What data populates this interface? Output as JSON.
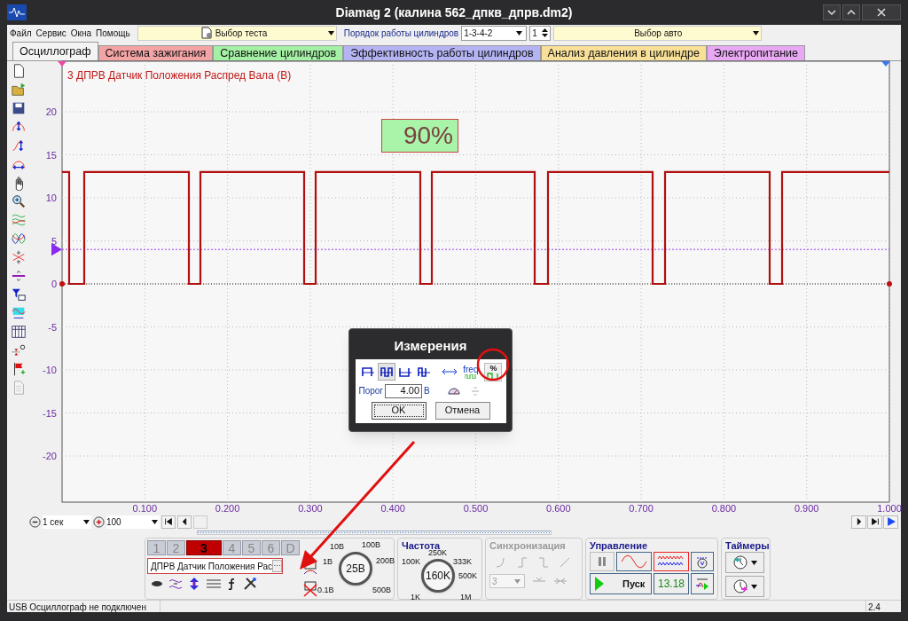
{
  "window": {
    "title": "Diamag 2 (калина 562_дпкв_дпрв.dm2)"
  },
  "menu": [
    "Файл",
    "Сервис",
    "Окна",
    "Помощь"
  ],
  "toolbar": {
    "test_select": "Выбор теста",
    "cylinder_order_label": "Порядок работы цилиндров",
    "cylinder_order": "1-3-4-2",
    "cylinder": "1",
    "car_select": "Выбор авто"
  },
  "tabs": [
    {
      "label": "Осциллограф",
      "selected": true,
      "color": "#f4f4f4"
    },
    {
      "label": "Система зажигания",
      "selected": false,
      "color": "#f4a4a4"
    },
    {
      "label": "Сравнение цилиндров",
      "selected": false,
      "color": "#a4f0a4"
    },
    {
      "label": "Эффективность работы цилиндров",
      "selected": false,
      "color": "#b4b4f4"
    },
    {
      "label": "Анализ давления в цилиндре",
      "selected": false,
      "color": "#f8e098"
    },
    {
      "label": "Электропитание",
      "selected": false,
      "color": "#e8a8f4"
    }
  ],
  "chart": {
    "trace_label": "3 ДПРВ Датчик Положения Распред Вала (В)",
    "duty_reading": "90%",
    "yticks": [
      "20",
      "15",
      "10",
      "5",
      "0",
      "-5",
      "-10",
      "-15",
      "-20"
    ],
    "xticks": [
      "0.100",
      "0.200",
      "0.300",
      "0.400",
      "0.500",
      "0.600",
      "0.700",
      "0.800",
      "0.900",
      "1.000"
    ]
  },
  "time_scale": {
    "period": "1 сек",
    "zoom": "100"
  },
  "dialog": {
    "title": "Измерения",
    "pulse_modes": [
      {
        "selected": false
      },
      {
        "selected": true
      },
      {
        "selected": false
      },
      {
        "selected": false
      }
    ],
    "freq_label": "freq",
    "percent_label": "%",
    "threshold_label": "Порог",
    "threshold": "4.00",
    "unit": "В",
    "ok": "OK",
    "cancel": "Отмена"
  },
  "channels": {
    "tabs": [
      {
        "label": "1",
        "selected": false
      },
      {
        "label": "2",
        "selected": false
      },
      {
        "label": "3",
        "selected": true
      },
      {
        "label": "4",
        "selected": false
      },
      {
        "label": "5",
        "selected": false
      },
      {
        "label": "6",
        "selected": false
      },
      {
        "label": "D",
        "selected": false
      }
    ],
    "sensor": "ДПРВ Датчик Положения Рас",
    "more": "···"
  },
  "voltage_knob": {
    "value": "25В",
    "marks": [
      "0.1В",
      "1В",
      "10В",
      "100В",
      "200В",
      "500В"
    ]
  },
  "frequency": {
    "title": "Частота",
    "value": "160K",
    "marks": [
      "1K",
      "100K",
      "250K",
      "333K",
      "500K",
      "1M"
    ]
  },
  "sync": {
    "title": "Синхронизация",
    "channel": "3",
    "disabled": true
  },
  "control": {
    "title": "Управление",
    "start": "Пуск",
    "reading": "13.18"
  },
  "timers": {
    "title": "Таймеры"
  },
  "status_bar": {
    "message": "USB Осциллограф не подключен",
    "version": "2.4"
  }
}
